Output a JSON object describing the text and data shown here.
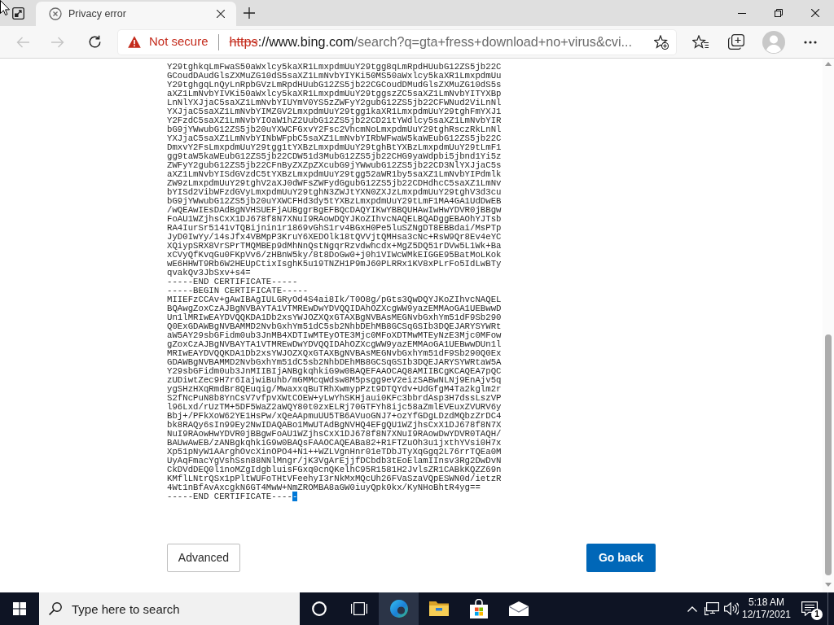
{
  "tabs": [
    {
      "title": "Privacy error",
      "selected": true
    }
  ],
  "toolbar": {
    "back": {
      "disabled": true
    },
    "forward": {
      "disabled": true
    }
  },
  "address_bar": {
    "security_label": "Not secure",
    "scheme": "https",
    "host": "://www.bing.com",
    "path": "/search?q=gta+fress+download+no+virus&cvi..."
  },
  "certificate": {
    "lines": [
      "Y29tghkqLmFwaS50aWxlcy5kaXR1LmxpdmUuY29tgg8qLmRpdHUubG12ZS5jb22C",
      "GCoudDAudGlsZXMuZG10dS5saXZ1LmNvbYIYKi50MS50aWxlcy5kaXR1LmxpdmUu",
      "Y29tghgqLnQyLnRpbGVzLmRpdHUubG12ZS5jb22CGCoudDMudGlsZXMuZG10dS5s",
      "aXZ1LmNvbYIVKi50aWxlcy5kaXR1LmxpdmUuY29tggszZC5saXZ1LmNvbYITYXBp",
      "LnNlYXJjaC5saXZ1LmNvbYIUYmV0YS5zZWFyY2gubG12ZS5jb22CFWNud2ViLnNl",
      "YXJjaC5saXZ1LmNvbYIMZGV2LmxpdmUuY29tgg1kaXR1LmxpdmUuY29tghFmYXJ1",
      "Y2FzdC5saXZ1LmNvbYIOaW1hZ2UubG12ZS5jb22CD21tYWdlcy5saXZ1LmNvbYIR",
      "bG9jYWwubG12ZS5jb20uYXWCFGxvY2Fsc2VhcmNoLmxpdmUuY29tghRsczRkLnNl",
      "YXJjaC5saXZ1LmNvbYINbWFpbC5saXZ1LmNvbYIRbWFwaW5kaWEubG12ZS5jb22C",
      "DmxvY2FsLmxpdmUuY29tgg1tYXBzLmxpdmUuY29tghBtYXBzLmxpdmUuY29tLmF1",
      "gg9taW5kaWEubG12ZS5jb22CDW51d3MubG12ZS5jb22CHG9yaWdpbi5jbnd1Yi5z",
      "ZWFyY2gubG12ZS5jb22CFnByZXZpZXcubG9jYWwubG12ZS5jb22CD3NlYXJjaC5s",
      "aXZ1LmNvbYISdGVzdC5tYXBzLmxpdmUuY29tgg52aWR1by5saXZ1LmNvbYIPdmlk",
      "ZW9zLmxpdmUuY29tghV2aXJ0dWFsZWFydGgubG12ZS5jb22CDHdhcC5saXZ1LmNv",
      "bYISd2VibWFzdGVyLmxpdmUuY29tghN3ZWJtYXN0ZXJzLmxpdmUuY29tghV3d3cu",
      "bG9jYWwubG12ZS5jb20uYXWCFHd3dy5tYXBzLmxpdmUuY29tLmF1MA4GA1UdDwEB",
      "/wQEAwIEsDAdBgNVHSUEFjAUBggrBgEFBQcDAQYIKwYBBQUHAwIwHwYDVR0jBBgw",
      "FoAU1WZjhsCxX1DJ678f8N7XNuI9RAowDQYJKoZIhvcNAQELBQADggEBAOhYJTsb",
      "RA4IurSr5141vTQBijnin1r1869vGhS1rv4BGxH0Pe5luSZNgDT8EBBdai/MsPTp",
      "JyD0IwYy/14sJfx4VBMpP3KruY6XEDOlk18tQVVjtQMHsa3cNc+RsW9Qr8Ev4eYC",
      "XQiypSRX8VrSPrTMQMBEp9dMhNnQstNgqrRzvdwhcdx+MgZ5DQ51rDVw5L1Wk+Ba",
      "xCVyQfKvqGu0FKpVv6/zHBnW5ky/8t8DoGw0+j0h1VIWcWMkEIGGE95BatMoLKok",
      "wE6HHWT9Rb6W2HEUpCtixIsghK5u19TNZH1P9mJ60PLRRx1KV8xPLrFo5IdLwBTy",
      "qvakQv3JbSxv+s4=",
      "-----END CERTIFICATE-----",
      "-----BEGIN CERTIFICATE-----",
      "MIIEFzCCAv+gAwIBAgIULGRyOd4S4ai8Ik/T0O8g/pGts3QwDQYJKoZIhvcNAQEL",
      "BQAwgZoxCzAJBgNVBAYTA1VTMREwDwYDVQQIDAhOZXcgWW9yazEMMAoGA1UEBwwD",
      "Un1lMRIwEAYDVQQKDA1Db2xsYWJOZXQxGTAXBgNVBAsMEGNvbGxhYm51dF9Sb290",
      "Q0ExGDAWBgNVBAMMD2NvbGxhYm51dC5sb2NhbDEhMB8GCSqGSIb3DQEJARYSYWRt",
      "aW5AY29sbGFidm0ub3JnMB4XDTIwMTEyOTE3Mjc0MFoXDTMwMTEyNzE3Mjc0MFow",
      "gZoxCzAJBgNVBAYTA1VTMREwDwYDVQQIDAhOZXcgWW9yazEMMAoGA1UEBwwDUn1l",
      "MRIwEAYDVQQKDA1Db2xsYWJOZXQxGTAXBgNVBAsMEGNvbGxhYm51dF9Sb290Q0Ex",
      "GDAWBgNVBAMMD2NvbGxhYm51dC5sb2NhbDEhMB8GCSqGSIb3DQEJARYSYWRtaW5A",
      "Y29sbGFidm0ub3JnMIIBIjANBgkqhkiG9w0BAQEFAAOCAQ8AMIIBCgKCAQEA7pQC",
      "zUDiwtZec9H7r6IajwiBuhb/mGMMcqWdsw8M5psgg9eV2eizSABwNLNj9EnAjv5q",
      "ygSHzHXqRmdBr8QEuqig/MwaxxqBuTRhXwmypPzt9DTQYdv+UdGfgM4Ta2kglm2r",
      "S2fNcPuN8b8YnCsV7vfpvXWtCOEW+yLwYhSKHjaui0KFc3bbrdAsp3H7dssLszVP",
      "l96Lxd/rUzTM+5DF5WaZ2aWQY80t0zxELRj70GTFYh8ijc58aZmlEVEuxZVURV6y",
      "Bbj+/PFkXoW62YE1HsPw/xQeAApmuUU5TB6AVuoGNJ7+ozYfGDgLDzdMQbzZrDC4",
      "bk8RAQy6sIn99Ey2NwIDAQABo1MwUTAdBgNVHQ4EFgQU1WZjhsCxX1DJ678f8N7X",
      "NuI9RAowHwYDVR0jBBgwFoAU1WZjhsCxX1DJ678f8N7XNuI9RAowDwYDVR0TAQH/",
      "BAUwAwEB/zANBgkqhkiG9w0BAQsFAAOCAQEABa82+R1FTZuOh3u1jxthYVsi0H7x",
      "Xp51pNyW1AArghOvcXinOPO4+N1++WZLVgnHnr01eTDbJTyXqGgq2L76rrTQEa0M",
      "UyAqFmacYgVshSsn88NNlMngr/jK3VgArEjjfDCbdb3tEoElamIInsv3Rg2DwDvN",
      "CkDVdDEQ0l1noMZgIdgbluisFGxq0cnQKelhC95R1581H2JvlsZR1CABkKQZZ69n",
      "KMflLNtrQSx1pPltWUFoTHtVFeehyI3rNkMxMQcUh26FVaSzaVQpESWN0d/ietzR",
      "4Wt1nBfAvAxcgkN6GT4MwW+NmZROMBA8aGW0iuyQpk0kx/KyNHoBhtR4yg==",
      "-----END CERTIFICATE----"
    ],
    "selected_text": "-"
  },
  "buttons": [
    {
      "label": "Advanced",
      "kind": "secondary"
    },
    {
      "label": "Go back",
      "kind": "primary"
    }
  ],
  "taskbar": {
    "search": {
      "placeholder": "Type here to search"
    },
    "apps": [
      {
        "kind": "browser",
        "active": true
      },
      {
        "kind": "folder",
        "active": false
      },
      {
        "kind": "store",
        "active": false
      },
      {
        "kind": "mail",
        "active": false
      }
    ],
    "clock": {
      "time": "5:18 AM",
      "date": "12/17/2021"
    },
    "notifications": {
      "count": "1"
    }
  }
}
